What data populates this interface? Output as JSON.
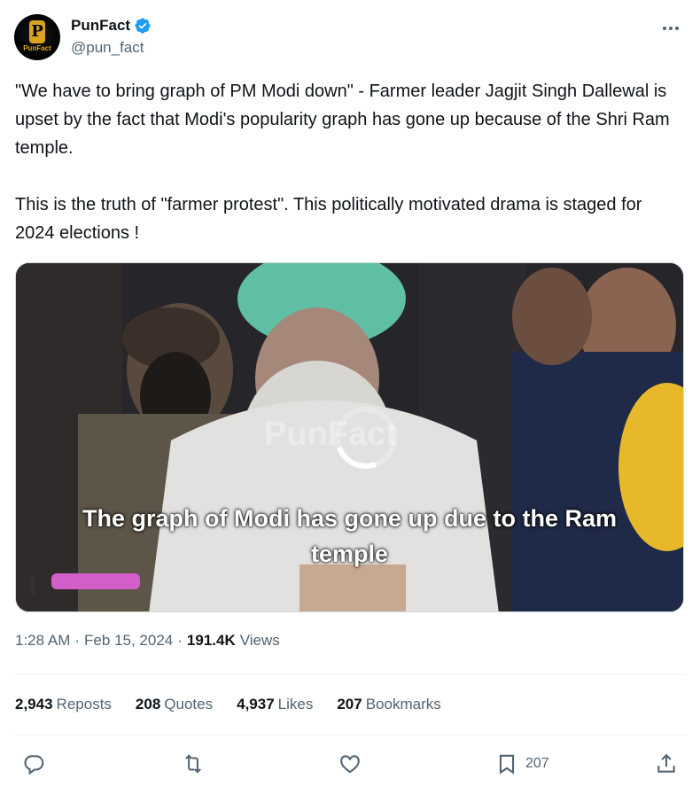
{
  "author": {
    "display_name": "PunFact",
    "handle": "@pun_fact",
    "avatar_letter": "P",
    "avatar_word": "PunFact",
    "verified": true
  },
  "tweet": {
    "paragraph1": "\"We have to bring graph of PM Modi down\" - Farmer leader Jagjit Singh Dallewal is upset by the fact that Modi's popularity graph has gone up because of the Shri Ram temple.",
    "paragraph2": "This is the truth of \"farmer protest\". This politically motivated drama is staged for 2024 elections !"
  },
  "media": {
    "watermark": "PunFact",
    "caption_line1": "The graph of Modi has gone up due to the Ram",
    "caption_line2": "temple"
  },
  "meta": {
    "time": "1:28 AM",
    "sep1": "·",
    "date": "Feb 15, 2024",
    "sep2": "·",
    "views_count": "191.4K",
    "views_label": "Views"
  },
  "stats": {
    "reposts_count": "2,943",
    "reposts_label": "Reposts",
    "quotes_count": "208",
    "quotes_label": "Quotes",
    "likes_count": "4,937",
    "likes_label": "Likes",
    "bookmarks_count": "207",
    "bookmarks_label": "Bookmarks"
  },
  "actions": {
    "reply_icon": "reply-icon",
    "repost_icon": "repost-icon",
    "like_icon": "heart-icon",
    "bookmark_icon": "bookmark-icon",
    "bookmark_count": "207",
    "share_icon": "share-icon"
  },
  "colors": {
    "verified_blue": "#1d9bf0",
    "secondary_text": "#536471",
    "primary_text": "#0f1419"
  }
}
